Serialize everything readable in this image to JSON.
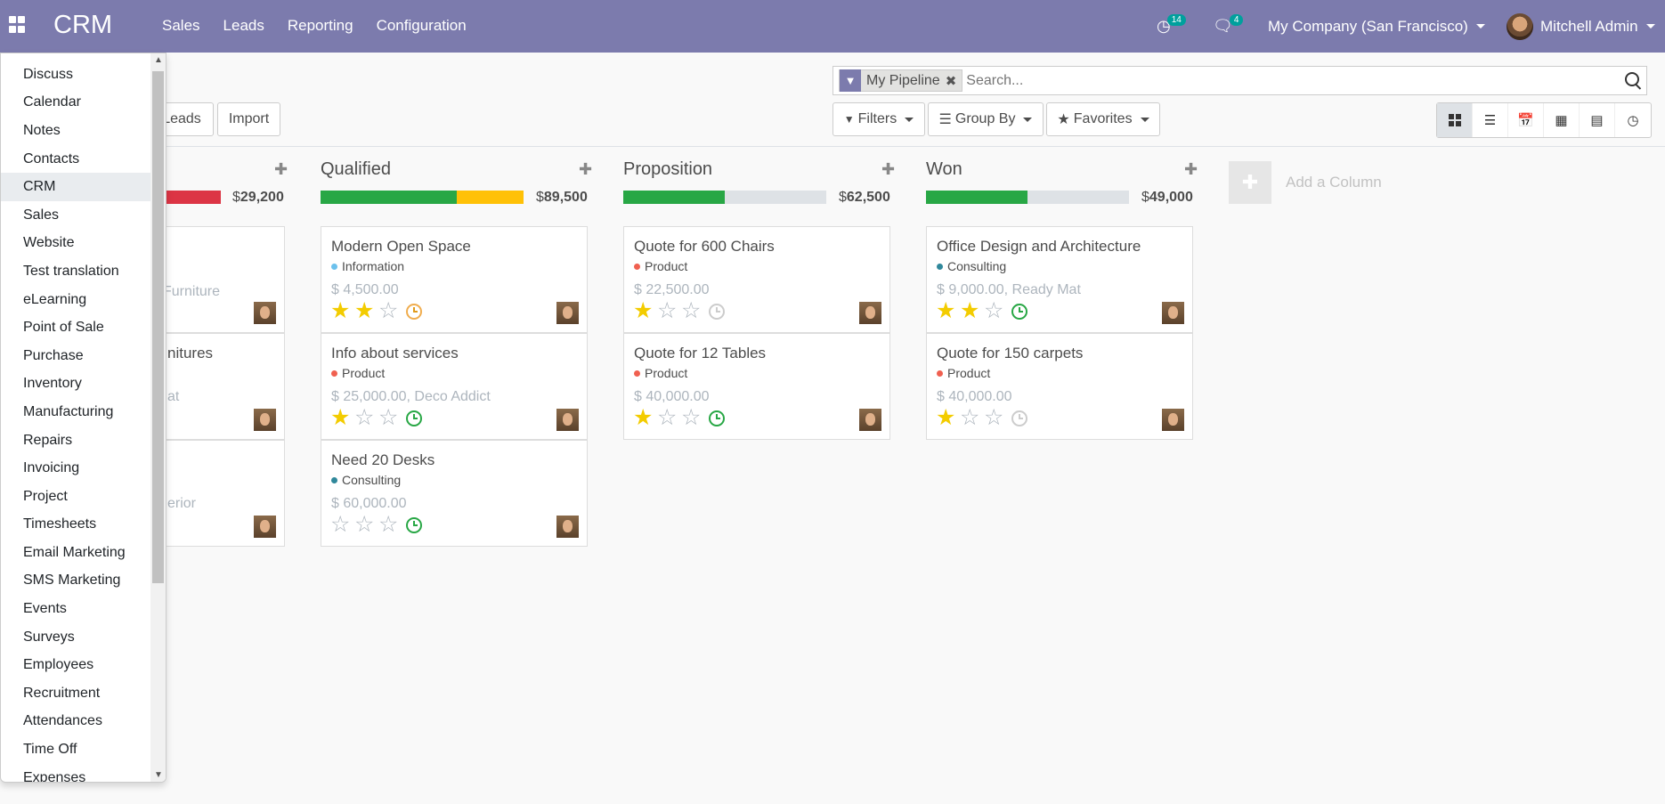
{
  "navbar": {
    "brand": "CRM",
    "menu": [
      "Sales",
      "Leads",
      "Reporting",
      "Configuration"
    ],
    "activity_count": "14",
    "message_count": "4",
    "company": "My Company (San Francisco)",
    "user": "Mitchell Admin"
  },
  "control_panel": {
    "leads_label": "Leads",
    "import_label": "Import",
    "facet_label": "My Pipeline",
    "search_placeholder": "Search...",
    "filters_label": "Filters",
    "groupby_label": "Group By",
    "favorites_label": "Favorites"
  },
  "colors": {
    "navbar": "#7c7bad",
    "progress_green": "#28a745",
    "progress_yellow": "#ffc107",
    "progress_red": "#dc3545",
    "star_on": "#f3cc00"
  },
  "kanban": {
    "partial_column": {
      "total_currency": "$",
      "total_value": "29,200",
      "card_fragments": [
        "Furniture",
        "nitures",
        "at",
        "erior"
      ]
    },
    "columns": [
      {
        "title": "Qualified",
        "total_currency": "$",
        "total_value": "89,500",
        "progress": {
          "green": 0.67,
          "yellow": 0.33
        },
        "cards": [
          {
            "title": "Modern Open Space",
            "tag": "Information",
            "tag_color": "#6cc1ed",
            "amount": "$ 4,500.00",
            "stars": 2,
            "activity": "orange"
          },
          {
            "title": "Info about services",
            "tag": "Product",
            "tag_color": "#f06050",
            "amount": "$ 25,000.00, Deco Addict",
            "stars": 1,
            "activity": "green"
          },
          {
            "title": "Need 20 Desks",
            "tag": "Consulting",
            "tag_color": "#30889b",
            "amount": "$ 60,000.00",
            "stars": 0,
            "activity": "green"
          }
        ]
      },
      {
        "title": "Proposition",
        "total_currency": "$",
        "total_value": "62,500",
        "progress": {
          "green": 0.5,
          "yellow": 0
        },
        "cards": [
          {
            "title": "Quote for 600 Chairs",
            "tag": "Product",
            "tag_color": "#f06050",
            "amount": "$ 22,500.00",
            "stars": 1,
            "activity": "grey"
          },
          {
            "title": "Quote for 12 Tables",
            "tag": "Product",
            "tag_color": "#f06050",
            "amount": "$ 40,000.00",
            "stars": 1,
            "activity": "green"
          }
        ]
      },
      {
        "title": "Won",
        "total_currency": "$",
        "total_value": "49,000",
        "progress": {
          "green": 0.5,
          "yellow": 0
        },
        "cards": [
          {
            "title": "Office Design and Architecture",
            "tag": "Consulting",
            "tag_color": "#30889b",
            "amount": "$ 9,000.00, Ready Mat",
            "stars": 2,
            "activity": "green"
          },
          {
            "title": "Quote for 150 carpets",
            "tag": "Product",
            "tag_color": "#f06050",
            "amount": "$ 40,000.00",
            "stars": 1,
            "activity": "grey"
          }
        ]
      }
    ],
    "add_column_label": "Add a Column"
  },
  "apps_menu": {
    "items": [
      "Discuss",
      "Calendar",
      "Notes",
      "Contacts",
      "CRM",
      "Sales",
      "Website",
      "Test translation",
      "eLearning",
      "Point of Sale",
      "Purchase",
      "Inventory",
      "Manufacturing",
      "Repairs",
      "Invoicing",
      "Project",
      "Timesheets",
      "Email Marketing",
      "SMS Marketing",
      "Events",
      "Surveys",
      "Employees",
      "Recruitment",
      "Attendances",
      "Time Off",
      "Expenses"
    ],
    "active": "CRM"
  }
}
